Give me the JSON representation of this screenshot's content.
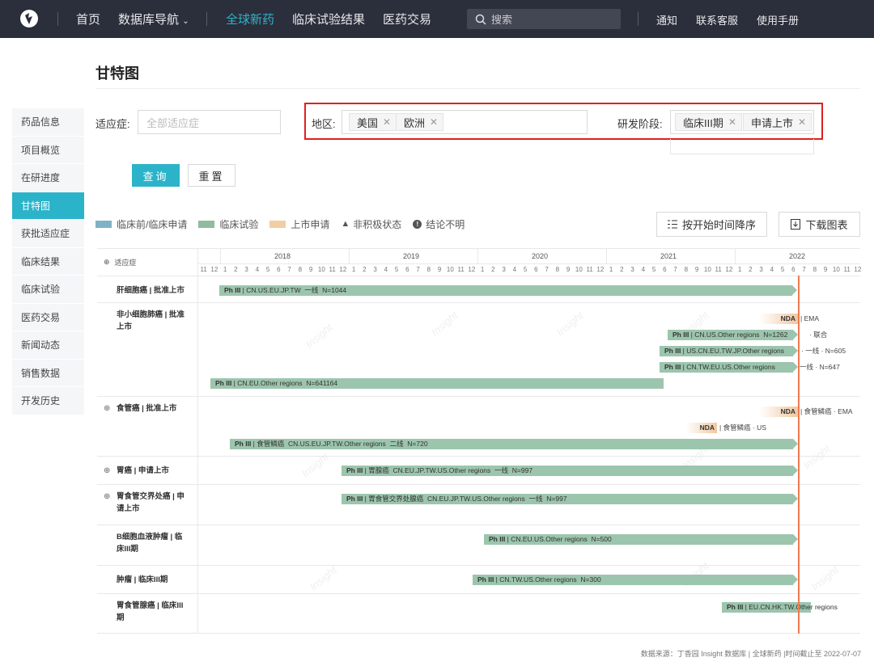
{
  "nav": {
    "items": [
      "首页",
      "数据库导航",
      "全球新药",
      "临床试验结果",
      "医药交易"
    ],
    "search_placeholder": "搜索",
    "right_links": [
      "通知",
      "联系客服",
      "使用手册"
    ]
  },
  "page_title": "甘特图",
  "sidebar": [
    "药品信息",
    "项目概览",
    "在研进度",
    "甘特图",
    "获批适应症",
    "临床结果",
    "临床试验",
    "医药交易",
    "新闻动态",
    "销售数据",
    "开发历史"
  ],
  "filters": {
    "indication_label": "适应症:",
    "indication_placeholder": "全部适应症",
    "region_label": "地区:",
    "region_tags": [
      "美国",
      "欧洲"
    ],
    "phase_label": "研发阶段:",
    "phase_tags": [
      "临床III期",
      "申请上市"
    ],
    "query_button": "查询",
    "reset_button": "重置"
  },
  "legend": {
    "items": [
      "临床前/临床申请",
      "临床试验",
      "上市申请",
      "非积极状态",
      "结论不明"
    ],
    "colors": [
      "#7fb2c6",
      "#8fbba0",
      "#f0cfa3"
    ],
    "sort_button": "按开始时间降序",
    "download_button": "下载图表"
  },
  "gantt": {
    "header_label": "适应症",
    "years": [
      "2018",
      "2019",
      "2020",
      "2021",
      "2022"
    ],
    "months": [
      "11",
      "12",
      "1",
      "2",
      "3",
      "4",
      "5",
      "6",
      "7",
      "8",
      "9",
      "10",
      "11",
      "12",
      "1",
      "2",
      "3",
      "4",
      "5",
      "6",
      "7",
      "8",
      "9",
      "10",
      "11",
      "12",
      "1",
      "2",
      "3",
      "4",
      "5",
      "6",
      "7",
      "8",
      "9",
      "10",
      "11",
      "12",
      "1",
      "2",
      "3",
      "4",
      "5",
      "6",
      "7",
      "8",
      "9",
      "10",
      "11",
      "12",
      "1",
      "2",
      "3",
      "4",
      "5",
      "6",
      "7",
      "8",
      "9",
      "10",
      "11",
      "12"
    ],
    "rows": [
      {
        "label": "肝细胞癌 | 批准上市",
        "plus": false
      },
      {
        "label": "非小细胞肺癌 | 批准上市",
        "plus": false
      },
      {
        "label": "食管癌 | 批准上市",
        "plus": true
      },
      {
        "label": "胃癌 | 申请上市",
        "plus": true
      },
      {
        "label": "胃食管交界处癌 | 申请上市",
        "plus": true
      },
      {
        "label": "B细胞血液肿瘤 | 临床III期",
        "plus": false
      },
      {
        "label": "肿瘤 | 临床III期",
        "plus": false
      },
      {
        "label": "胃食管腺癌 | 临床III期",
        "plus": false
      }
    ],
    "bars": {
      "b1": {
        "ph": "Ph III",
        "text": "CN.US.EU.JP.TW",
        "note": "一线",
        "n": "N=1044"
      },
      "b2": {
        "ph": "Ph III",
        "text": "CN.US.Other regions",
        "n": "N=1262",
        "note": "· 联合"
      },
      "b3": {
        "ph": "Ph III",
        "text": "US.CN.EU.TW.JP.Other regions",
        "note": "一线",
        "n": "N=605"
      },
      "b4": {
        "ph": "Ph III",
        "text": "CN.TW.EU.US.Other regions",
        "note": "一线",
        "n": "N=647"
      },
      "b5": {
        "ph": "Ph III",
        "text": "CN.EU.Other regions",
        "n": "N=641164"
      },
      "b6": {
        "ph": "Ph III",
        "text": "食管鳞癌",
        "region": "CN.US.EU.JP.TW.Other regions",
        "note": "二线",
        "n": "N=720"
      },
      "b7": {
        "ph": "Ph III",
        "text": "胃腺癌",
        "region": "CN.EU.JP.TW.US.Other regions",
        "note": "一线",
        "n": "N=997"
      },
      "b8": {
        "ph": "Ph III",
        "text": "胃食管交界处腺癌",
        "region": "CN.EU.JP.TW.US.Other regions",
        "note": "一线",
        "n": "N=997"
      },
      "b9": {
        "ph": "Ph III",
        "text": "CN.EU.US.Other regions",
        "n": "N=500"
      },
      "b10": {
        "ph": "Ph III",
        "text": "CN.TW.US.Other regions",
        "n": "N=300"
      },
      "b11": {
        "ph": "Ph III",
        "text": "EU.CN.HK.TW.Other regions"
      }
    },
    "nda": {
      "n1": {
        "label": "NDA",
        "region": "EMA"
      },
      "n2": {
        "label": "NDA",
        "note": "食管鳞癌",
        "region": "EMA"
      },
      "n3": {
        "label": "NDA",
        "note": "食管鳞癌",
        "region": "US"
      }
    },
    "watermark": "Insight"
  },
  "footer": "数据来源：丁香园 Insight 数据库 | 全球新药 |时间截止至 2022-07-07"
}
